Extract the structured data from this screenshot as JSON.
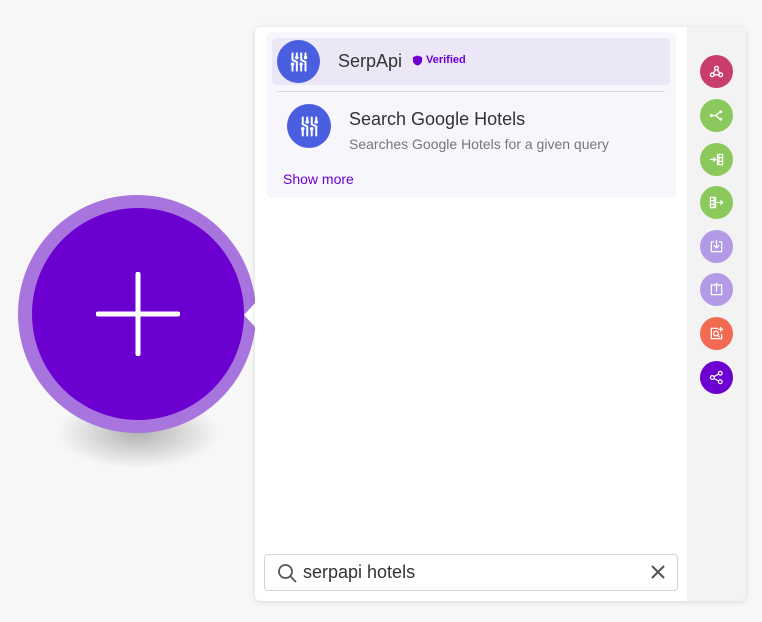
{
  "app": {
    "name": "SerpApi",
    "badge": "Verified",
    "module": {
      "title": "Search Google Hotels",
      "description": "Searches Google Hotels for a given query"
    },
    "show_more": "Show more"
  },
  "search": {
    "value": "serpapi hotels"
  },
  "node": {
    "icon": "plus-icon",
    "color": "#6c00d0",
    "ring_color": "#a874de"
  },
  "tools": [
    {
      "icon": "webhooks-icon",
      "color": "#c83d6e"
    },
    {
      "icon": "flow-control-router-icon",
      "color": "#8cc95c"
    },
    {
      "icon": "iterator-icon",
      "color": "#8cc95c"
    },
    {
      "icon": "aggregator-icon",
      "color": "#8cc95c"
    },
    {
      "icon": "import-icon",
      "color": "#b39ae7"
    },
    {
      "icon": "export-icon",
      "color": "#b39ae7"
    },
    {
      "icon": "search-tool-icon",
      "color": "#f26a52"
    },
    {
      "icon": "share-icon",
      "color": "#6c00d0"
    }
  ],
  "colors": {
    "accent": "#6c00d0",
    "serpapi_logo": "#4a5fe0"
  }
}
